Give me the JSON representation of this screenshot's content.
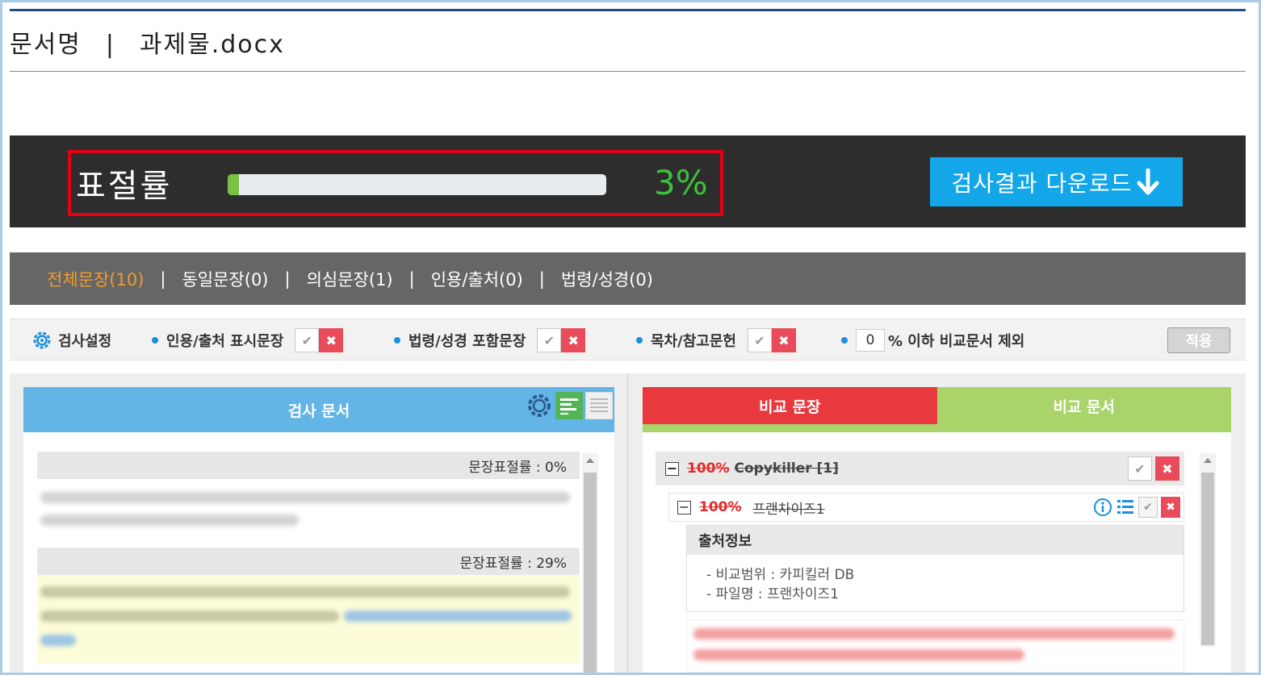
{
  "document": {
    "label": "문서명",
    "separator": "|",
    "filename": "과제물.docx"
  },
  "plagiarism": {
    "label": "표절률",
    "percent_value": 3,
    "percent_text": "3%",
    "download_label": "검사결과 다운로드",
    "colors": {
      "fill": "#7ac143",
      "value": "#3cc13c",
      "highlight_border": "#e60012"
    }
  },
  "filters": {
    "separator": "|",
    "tabs": [
      {
        "label": "전체문장(10)",
        "active": true
      },
      {
        "label": "동일문장(0)",
        "active": false
      },
      {
        "label": "의심문장(1)",
        "active": false
      },
      {
        "label": "인용/출처(0)",
        "active": false
      },
      {
        "label": "법령/성경(0)",
        "active": false
      }
    ]
  },
  "settings": {
    "title": "검사설정",
    "options": [
      {
        "label": "인용/출처 표시문장"
      },
      {
        "label": "법령/성경 포함문장"
      },
      {
        "label": "목차/참고문헌"
      }
    ],
    "threshold_value": "0",
    "threshold_label": "% 이하 비교문서 제외",
    "apply_label": "적용",
    "check_glyph": "✔",
    "x_glyph": "✖"
  },
  "left_panel": {
    "title": "검사 문서",
    "sentences": [
      {
        "rate_label": "문장표절률 : 0%"
      },
      {
        "rate_label": "문장표절률 : 29%"
      }
    ]
  },
  "right_panel": {
    "tab_compare_sentence": "비교 문장",
    "tab_compare_doc": "비교 문서",
    "group": {
      "toggle": "−",
      "percent": "100%",
      "name": "Copykiller [1]"
    },
    "item": {
      "toggle": "−",
      "percent": "100%",
      "name": "프랜차이즈1"
    },
    "source_info": {
      "title": "출처정보",
      "lines": [
        "- 비교범위 : 카피킬러 DB",
        "- 파일명 : 프랜차이즈1"
      ]
    }
  }
}
